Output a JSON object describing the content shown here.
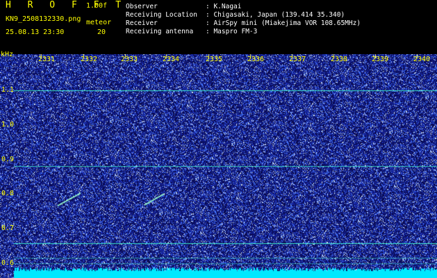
{
  "header": {
    "app_name": "H R O F F T",
    "version": "1.00f",
    "filename": "KN9_2508132330.png",
    "meteor_label": "meteor",
    "datetime": "25.08.13 23:30",
    "meteor_count": "20",
    "info": [
      {
        "label": "Observer",
        "value": ": K.Nagai"
      },
      {
        "label": "Receiving Location",
        "value": ": Chigasaki, Japan (139.414 35.340)"
      },
      {
        "label": "Receiver",
        "value": ": AirSpy mini (Miakejima VOR 108.65MHz)"
      },
      {
        "label": "Receiving antenna",
        "value": ": Maspro FM-3"
      }
    ]
  },
  "axes": {
    "y_unit": "kHz",
    "y_ticks": [
      "1.1",
      "1.0",
      "0.9",
      "0.8",
      "0.7",
      "0.6"
    ],
    "x_ticks": [
      "2331",
      "2332",
      "2333",
      "2334",
      "2335",
      "2336",
      "2337",
      "2338",
      "2339",
      "2340"
    ]
  },
  "colors": {
    "background": "#0a0a50",
    "noise": "#3a6cff",
    "signal_line": "#40ffd0",
    "baseline": "#00e8ff",
    "label": "#ffff00"
  }
}
